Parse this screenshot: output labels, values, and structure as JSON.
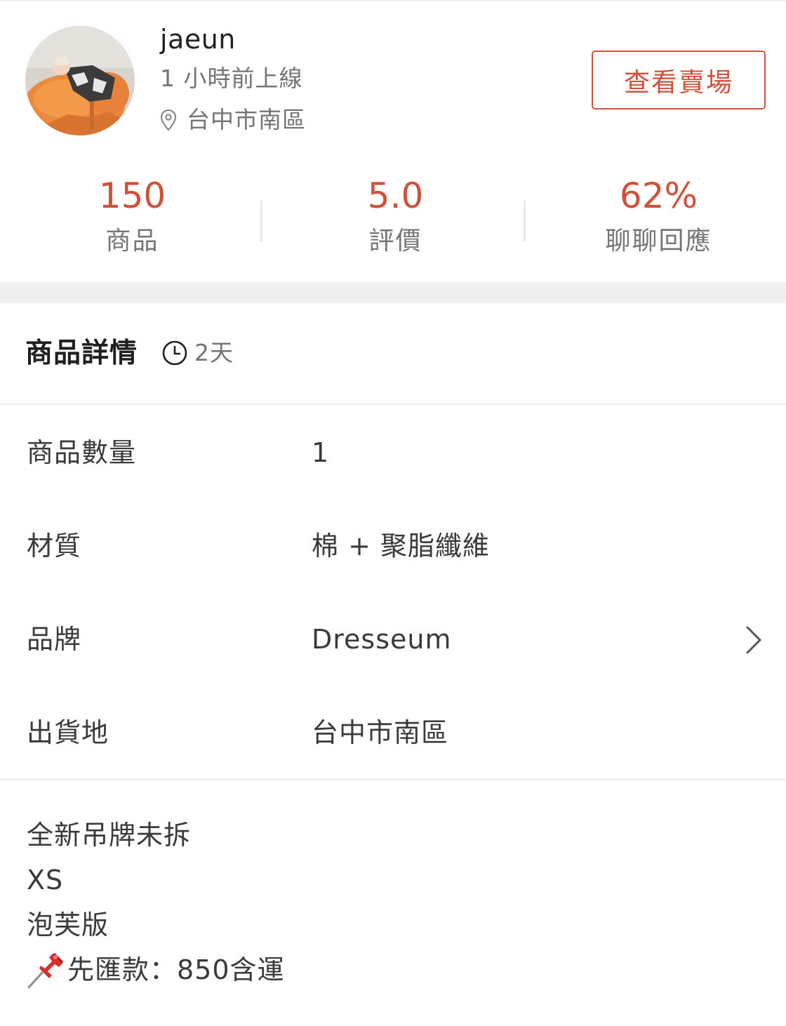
{
  "seller": {
    "name": "jaeun",
    "online_status": "1 小時前上線",
    "location": "台中市南區",
    "view_shop_label": "查看賣場",
    "avatar_icon": "seller-avatar-photo"
  },
  "stats": [
    {
      "value": "150",
      "label": "商品"
    },
    {
      "value": "5.0",
      "label": "評價"
    },
    {
      "value": "62%",
      "label": "聊聊回應"
    }
  ],
  "detail": {
    "title": "商品詳情",
    "listed_age": "2天",
    "specs": [
      {
        "label": "商品數量",
        "value": "1"
      },
      {
        "label": "材質",
        "value": "棉 + 聚脂纖維"
      },
      {
        "label": "品牌",
        "value": "Dresseum"
      },
      {
        "label": "出貨地",
        "value": "台中市南區"
      }
    ],
    "description_lines": [
      "全新吊牌未拆",
      "XS",
      "泡芙版",
      "先匯款：850含運"
    ]
  },
  "colors": {
    "accent": "#d0513a",
    "text_primary": "#1f1f1f",
    "text_secondary": "#757575",
    "divider": "#ececec",
    "band": "#efefef"
  },
  "icons": [
    "location-pin-icon",
    "clock-icon",
    "chevron-right-icon",
    "pushpin-icon"
  ]
}
